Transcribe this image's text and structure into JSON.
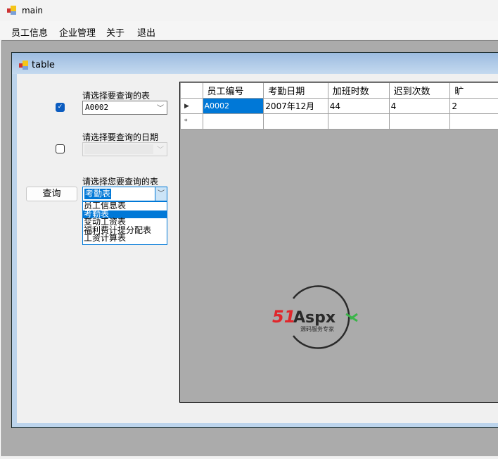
{
  "window": {
    "title": "main",
    "icon": "app-icon"
  },
  "menu": [
    "员工信息",
    "企业管理",
    "关于",
    "退出"
  ],
  "child": {
    "title": "table",
    "icon": "app-icon"
  },
  "form": {
    "label1": "请选择要查询的表",
    "checkbox1_checked": true,
    "combo1_value": "A0002",
    "label2": "请选择要查询的日期",
    "checkbox2_checked": false,
    "combo2_value": "",
    "label3": "请选择您要查询的表",
    "query_button": "查询",
    "combo3_value": "考勤表",
    "dropdown_items": [
      "员工信息表",
      "考勤表",
      "变动工资表",
      "福利费计提分配表",
      "工资计算表"
    ],
    "dropdown_selected": "考勤表"
  },
  "grid": {
    "columns": [
      "员工编号",
      "考勤日期",
      "加班时数",
      "迟到次数",
      "旷"
    ],
    "rows": [
      [
        "A0002",
        "2007年12月",
        "44",
        "4",
        "2"
      ]
    ],
    "current_row_marker": "▶",
    "new_row_marker": "*"
  },
  "logo": {
    "text": "51Aspx",
    "tagline": "源码服务专家",
    "colors": {
      "red": "#e0262b",
      "green": "#3bb54a",
      "dark": "#2a2a2a"
    }
  }
}
